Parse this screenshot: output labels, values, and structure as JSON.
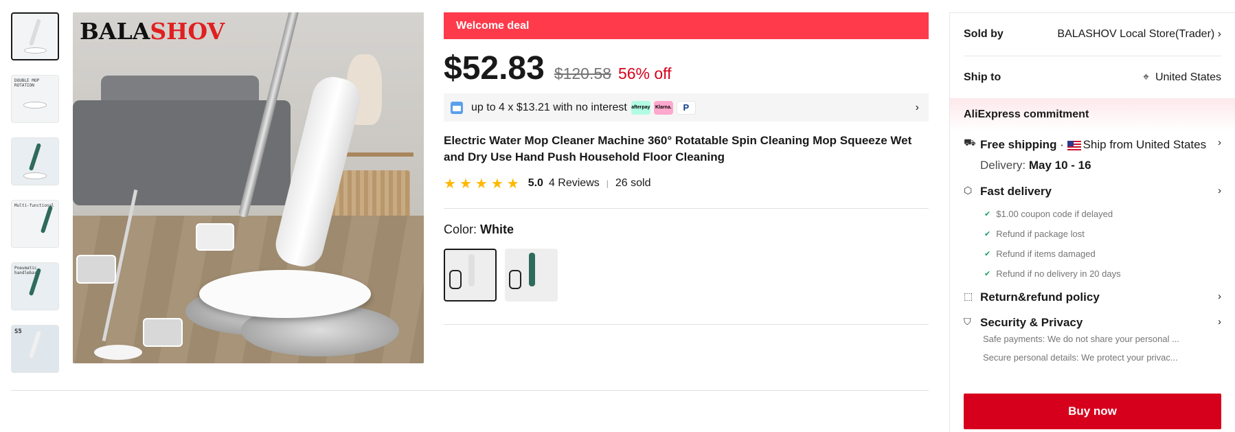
{
  "brand_logo": {
    "prefix": "BALA",
    "highlight": "SHOV",
    "suffix": ""
  },
  "thumbnails": [
    {
      "alt": "thumbnail-1"
    },
    {
      "caption": "DOUBLE MOP ROTATION"
    },
    {
      "caption": ""
    },
    {
      "caption": "Multi-functional"
    },
    {
      "caption": "Pneumatic handlebar"
    },
    {
      "caption": "S5"
    }
  ],
  "deal": {
    "label": "Welcome deal"
  },
  "price": {
    "current": "$52.83",
    "original": "$120.58",
    "discount": "56% off"
  },
  "installment": {
    "text": "up to 4 x $13.21 with no interest",
    "chips": [
      "afterpay",
      "Klarna.",
      "P"
    ]
  },
  "product": {
    "title": "Electric Water Mop Cleaner Machine 360° Rotatable Spin Cleaning Mop Squeeze Wet and Dry Use Hand Push Household Floor Cleaning",
    "rating": "5.0",
    "reviews": "4 Reviews",
    "sold": "26 sold",
    "star": "★",
    "separator": "|"
  },
  "color": {
    "label": "Color:",
    "value": "White"
  },
  "seller": {
    "label": "Sold by",
    "value": "BALASHOV Local Store(Trader)",
    "chev": "›"
  },
  "ship_to": {
    "label": "Ship to",
    "value": "United States",
    "pin": "⌖"
  },
  "commitment": {
    "title": "AliExpress commitment"
  },
  "free_shipping": {
    "title": "Free shipping",
    "dot": " · ",
    "from": "Ship from United States",
    "delivery_label": "Delivery:",
    "delivery_value": "May 10 - 16",
    "chev": "›"
  },
  "fast_delivery": {
    "title": "Fast delivery",
    "chev": "›",
    "bullets": [
      "$1.00 coupon code if delayed",
      "Refund if package lost",
      "Refund if items damaged",
      "Refund if no delivery in 20 days"
    ]
  },
  "return_policy": {
    "title": "Return&refund policy",
    "chev": "›"
  },
  "security": {
    "title": "Security & Privacy",
    "chev": "›",
    "lines": [
      "Safe payments: We do not share your personal ...",
      "Secure personal details: We protect your privac..."
    ]
  },
  "buy_button": {
    "label": "Buy now"
  },
  "colors": {
    "deal_red": "#fe3a4b",
    "buy_red": "#d6001c",
    "star": "#ffb800",
    "tick_green": "#1aa265"
  },
  "icons": {
    "truck": "truck-icon",
    "box": "package-icon",
    "return": "return-box-icon",
    "shield": "shield-icon",
    "pin": "location-pin-icon",
    "calendar": "calendar-icon"
  }
}
